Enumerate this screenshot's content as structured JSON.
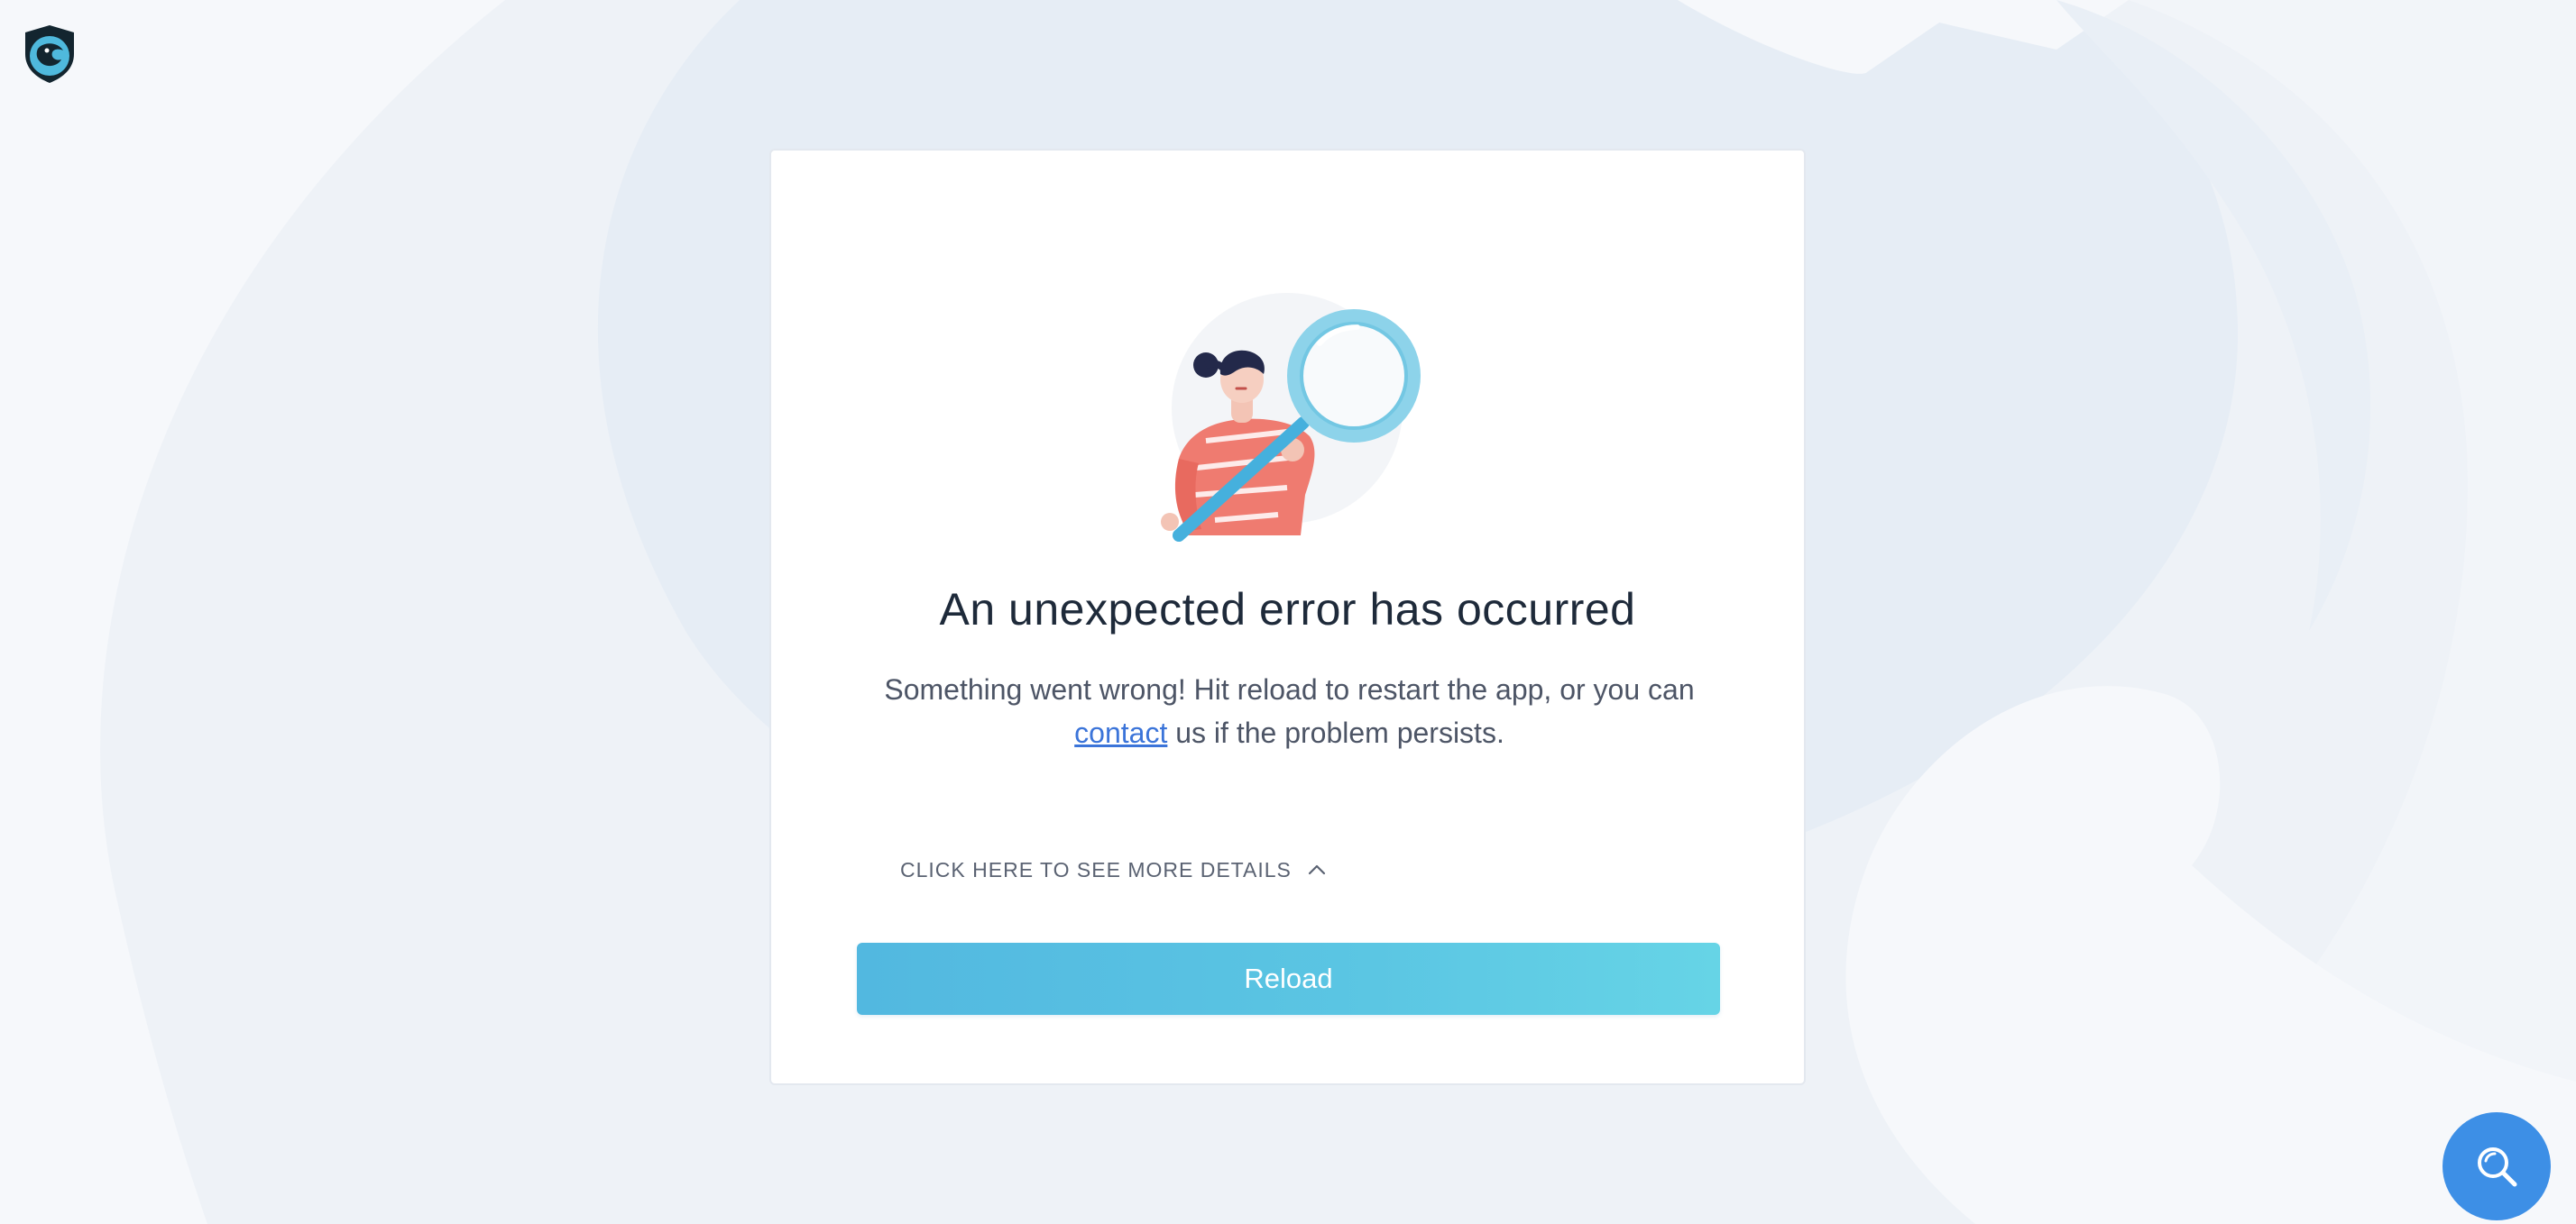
{
  "error": {
    "title": "An unexpected error has occurred",
    "message_before": "Something went wrong! Hit reload to restart the app, or you can",
    "contact_link": "contact",
    "message_after": "us if the problem persists.",
    "details_toggle": "CLICK HERE TO SEE MORE DETAILS",
    "reload_label": "Reload"
  },
  "icons": {
    "logo": "brand-logo-icon",
    "illustration": "magnifying-glass-person-illustration",
    "details_chevron": "chevron-up-icon",
    "help_fab": "search-icon"
  },
  "colors": {
    "accent": "#52b8e0",
    "link": "#3b74d9",
    "fab": "#3d8fe6",
    "title": "#1e2a3a"
  }
}
